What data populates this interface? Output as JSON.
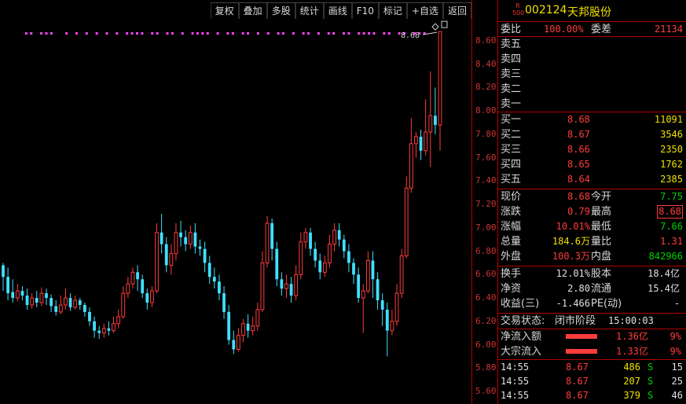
{
  "toolbar": [
    "复权",
    "叠加",
    "多股",
    "统计",
    "画线",
    "F10",
    "标记",
    "+自选",
    "返回"
  ],
  "chart": {
    "price_axis": [
      "8.60",
      "8.40",
      "8.20",
      "8.00",
      "7.80",
      "7.60",
      "7.40",
      "7.20",
      "7.00",
      "6.80",
      "6.60",
      "6.40",
      "6.20",
      "6.00",
      "5.80",
      "5.60"
    ],
    "high_marker": "8.68",
    "up_color": "#ff3c3c",
    "down_color": "#40e0ff"
  },
  "chart_data": {
    "type": "candlestick",
    "ylim": [
      5.52,
      8.74
    ],
    "candles": [
      [
        6.68,
        6.58,
        6.7,
        6.46
      ],
      [
        6.58,
        6.44,
        6.66,
        6.38
      ],
      [
        6.45,
        6.4,
        6.56,
        6.36
      ],
      [
        6.4,
        6.46,
        6.52,
        6.37
      ],
      [
        6.46,
        6.42,
        6.5,
        6.38
      ],
      [
        6.42,
        6.34,
        6.48,
        6.3
      ],
      [
        6.34,
        6.4,
        6.44,
        6.31
      ],
      [
        6.4,
        6.36,
        6.46,
        6.32
      ],
      [
        6.36,
        6.44,
        6.49,
        6.33
      ],
      [
        6.44,
        6.4,
        6.48,
        6.34
      ],
      [
        6.4,
        6.33,
        6.43,
        6.28
      ],
      [
        6.33,
        6.28,
        6.38,
        6.25
      ],
      [
        6.28,
        6.34,
        6.42,
        6.26
      ],
      [
        6.34,
        6.4,
        6.48,
        6.3
      ],
      [
        6.4,
        6.32,
        6.44,
        6.29
      ],
      [
        6.32,
        6.38,
        6.42,
        6.3
      ],
      [
        6.38,
        6.34,
        6.4,
        6.3
      ],
      [
        6.34,
        6.28,
        6.36,
        6.24
      ],
      [
        6.28,
        6.2,
        6.32,
        6.16
      ],
      [
        6.2,
        6.12,
        6.24,
        6.06
      ],
      [
        6.12,
        6.1,
        6.16,
        6.05
      ],
      [
        6.1,
        6.14,
        6.18,
        6.06
      ],
      [
        6.14,
        6.12,
        6.2,
        6.08
      ],
      [
        6.12,
        6.18,
        6.24,
        6.1
      ],
      [
        6.18,
        6.24,
        6.3,
        6.14
      ],
      [
        6.24,
        6.44,
        6.5,
        6.22
      ],
      [
        6.44,
        6.52,
        6.58,
        6.4
      ],
      [
        6.52,
        6.62,
        6.66,
        6.48
      ],
      [
        6.62,
        6.56,
        6.68,
        6.46
      ],
      [
        6.56,
        6.44,
        6.6,
        6.4
      ],
      [
        6.44,
        6.36,
        6.48,
        6.3
      ],
      [
        6.36,
        6.46,
        6.5,
        6.32
      ],
      [
        6.46,
        6.96,
        7.04,
        6.44
      ],
      [
        6.96,
        6.86,
        7.12,
        6.78
      ],
      [
        6.86,
        6.68,
        6.92,
        6.62
      ],
      [
        6.68,
        6.78,
        6.86,
        6.6
      ],
      [
        6.78,
        6.96,
        7.04,
        6.72
      ],
      [
        6.96,
        6.92,
        7.06,
        6.84
      ],
      [
        6.92,
        6.86,
        6.98,
        6.8
      ],
      [
        6.86,
        6.96,
        7.02,
        6.82
      ],
      [
        6.96,
        6.84,
        7.04,
        6.78
      ],
      [
        6.84,
        6.82,
        6.9,
        6.76
      ],
      [
        6.82,
        6.7,
        6.88,
        6.62
      ],
      [
        6.7,
        6.58,
        6.76,
        6.52
      ],
      [
        6.58,
        6.54,
        6.66,
        6.48
      ],
      [
        6.54,
        6.44,
        6.6,
        6.38
      ],
      [
        6.44,
        6.28,
        6.5,
        6.22
      ],
      [
        6.28,
        6.04,
        6.34,
        6.0
      ],
      [
        6.04,
        5.96,
        6.12,
        5.92
      ],
      [
        5.96,
        6.08,
        6.14,
        5.94
      ],
      [
        6.08,
        6.18,
        6.22,
        6.02
      ],
      [
        6.18,
        6.12,
        6.26,
        6.06
      ],
      [
        6.12,
        6.16,
        6.24,
        6.08
      ],
      [
        6.16,
        6.3,
        6.36,
        6.12
      ],
      [
        6.3,
        6.7,
        6.8,
        6.28
      ],
      [
        6.7,
        7.04,
        7.1,
        6.66
      ],
      [
        7.04,
        6.82,
        7.08,
        6.72
      ],
      [
        6.82,
        6.56,
        6.88,
        6.5
      ],
      [
        6.56,
        6.48,
        6.62,
        6.42
      ],
      [
        6.48,
        6.52,
        6.6,
        6.4
      ],
      [
        6.52,
        6.42,
        6.58,
        6.36
      ],
      [
        6.42,
        6.6,
        6.68,
        6.38
      ],
      [
        6.6,
        6.88,
        6.96,
        6.56
      ],
      [
        6.88,
        6.96,
        7.0,
        6.82
      ],
      [
        6.96,
        6.82,
        7.0,
        6.76
      ],
      [
        6.82,
        6.72,
        6.88,
        6.66
      ],
      [
        6.72,
        6.62,
        6.78,
        6.56
      ],
      [
        6.62,
        6.7,
        6.76,
        6.58
      ],
      [
        6.7,
        6.86,
        6.94,
        6.66
      ],
      [
        6.86,
        6.98,
        7.04,
        6.8
      ],
      [
        6.98,
        6.9,
        7.04,
        6.84
      ],
      [
        6.9,
        6.8,
        6.94,
        6.74
      ],
      [
        6.8,
        6.7,
        6.86,
        6.62
      ],
      [
        6.7,
        6.6,
        6.74,
        6.52
      ],
      [
        6.6,
        6.4,
        6.66,
        6.36
      ],
      [
        6.4,
        6.46,
        6.52,
        6.1
      ],
      [
        6.46,
        6.72,
        6.8,
        6.44
      ],
      [
        6.72,
        6.56,
        6.8,
        6.4
      ],
      [
        6.56,
        6.38,
        6.62,
        6.3
      ],
      [
        6.38,
        6.3,
        6.44,
        6.16
      ],
      [
        6.3,
        6.12,
        6.36,
        5.9
      ],
      [
        6.12,
        6.2,
        6.3,
        6.08
      ],
      [
        6.2,
        6.44,
        6.52,
        6.16
      ],
      [
        6.44,
        6.76,
        6.82,
        6.4
      ],
      [
        6.76,
        7.34,
        7.44,
        6.74
      ],
      [
        7.34,
        7.72,
        7.94,
        7.3
      ],
      [
        7.72,
        7.78,
        7.82,
        7.6
      ],
      [
        7.78,
        7.66,
        7.84,
        7.58
      ],
      [
        7.66,
        7.82,
        8.1,
        7.62
      ],
      [
        7.82,
        7.96,
        8.34,
        7.52
      ],
      [
        7.96,
        7.88,
        8.2,
        7.8
      ],
      [
        7.88,
        8.68,
        8.68,
        7.66
      ]
    ],
    "dot_markers": [
      2,
      3,
      5,
      6,
      7,
      10,
      12,
      14,
      16,
      18,
      20,
      22,
      23,
      24,
      25,
      27,
      28,
      30,
      31,
      33,
      35,
      36,
      37,
      38,
      40,
      42,
      43,
      45,
      46,
      48,
      50,
      52,
      53,
      55,
      57,
      58,
      60,
      62,
      63,
      65,
      66,
      68,
      69,
      70,
      71,
      73,
      74,
      76,
      77,
      79,
      80,
      81,
      83,
      84,
      86,
      88,
      89,
      90
    ]
  },
  "stock": {
    "badge_top": "R",
    "badge_bottom": "500",
    "code": "002124",
    "name": "天邦股份",
    "weibi_label": "委比",
    "weibi": "100.00%",
    "weicha_label": "委差",
    "weicha": "21134",
    "asks": [
      {
        "label": "卖五",
        "price": "",
        "vol": ""
      },
      {
        "label": "卖四",
        "price": "",
        "vol": ""
      },
      {
        "label": "卖三",
        "price": "",
        "vol": ""
      },
      {
        "label": "卖二",
        "price": "",
        "vol": ""
      },
      {
        "label": "卖一",
        "price": "",
        "vol": ""
      }
    ],
    "bids": [
      {
        "label": "买一",
        "price": "8.68",
        "vol": "11091"
      },
      {
        "label": "买二",
        "price": "8.67",
        "vol": "3546"
      },
      {
        "label": "买三",
        "price": "8.66",
        "vol": "2350"
      },
      {
        "label": "买四",
        "price": "8.65",
        "vol": "1762"
      },
      {
        "label": "买五",
        "price": "8.64",
        "vol": "2385"
      }
    ],
    "quote": [
      {
        "l1": "现价",
        "v1": "8.68",
        "c1": "red",
        "l2": "今开",
        "v2": "7.75",
        "c2": "grn"
      },
      {
        "l1": "涨跌",
        "v1": "0.79",
        "c1": "red",
        "l2": "最高",
        "v2": "8.68",
        "c2": "red"
      },
      {
        "l1": "涨幅",
        "v1": "10.01%",
        "c1": "red",
        "l2": "最低",
        "v2": "7.66",
        "c2": "grn"
      },
      {
        "l1": "总量",
        "v1": "184.6万",
        "c1": "yel",
        "l2": "量比",
        "v2": "1.31",
        "c2": "red"
      },
      {
        "l1": "外盘",
        "v1": "100.3万",
        "c1": "red",
        "l2": "内盘",
        "v2": "842966",
        "c2": "grn"
      }
    ],
    "fund": [
      {
        "l1": "换手",
        "v1": "12.01%",
        "l2": "股本",
        "v2": "18.4亿"
      },
      {
        "l1": "净资",
        "v1": "2.80",
        "l2": "流通",
        "v2": "15.4亿"
      },
      {
        "l1": "收益(三)",
        "v1": "-1.466",
        "l2": "PE(动)",
        "v2": "-"
      }
    ],
    "status_label": "交易状态:",
    "status_value": "闭市阶段",
    "status_time": "15:00:03",
    "flows": [
      {
        "label": "净流入额",
        "value": "1.36亿",
        "pct": "9%"
      },
      {
        "label": "大宗流入",
        "value": "1.33亿",
        "pct": "9%"
      }
    ],
    "ticks": [
      {
        "time": "14:55",
        "price": "8.67",
        "vol": "486",
        "side": "S",
        "n": "15"
      },
      {
        "time": "14:55",
        "price": "8.67",
        "vol": "207",
        "side": "S",
        "n": "25"
      },
      {
        "time": "14:55",
        "price": "8.67",
        "vol": "379",
        "side": "S",
        "n": "46"
      }
    ]
  }
}
